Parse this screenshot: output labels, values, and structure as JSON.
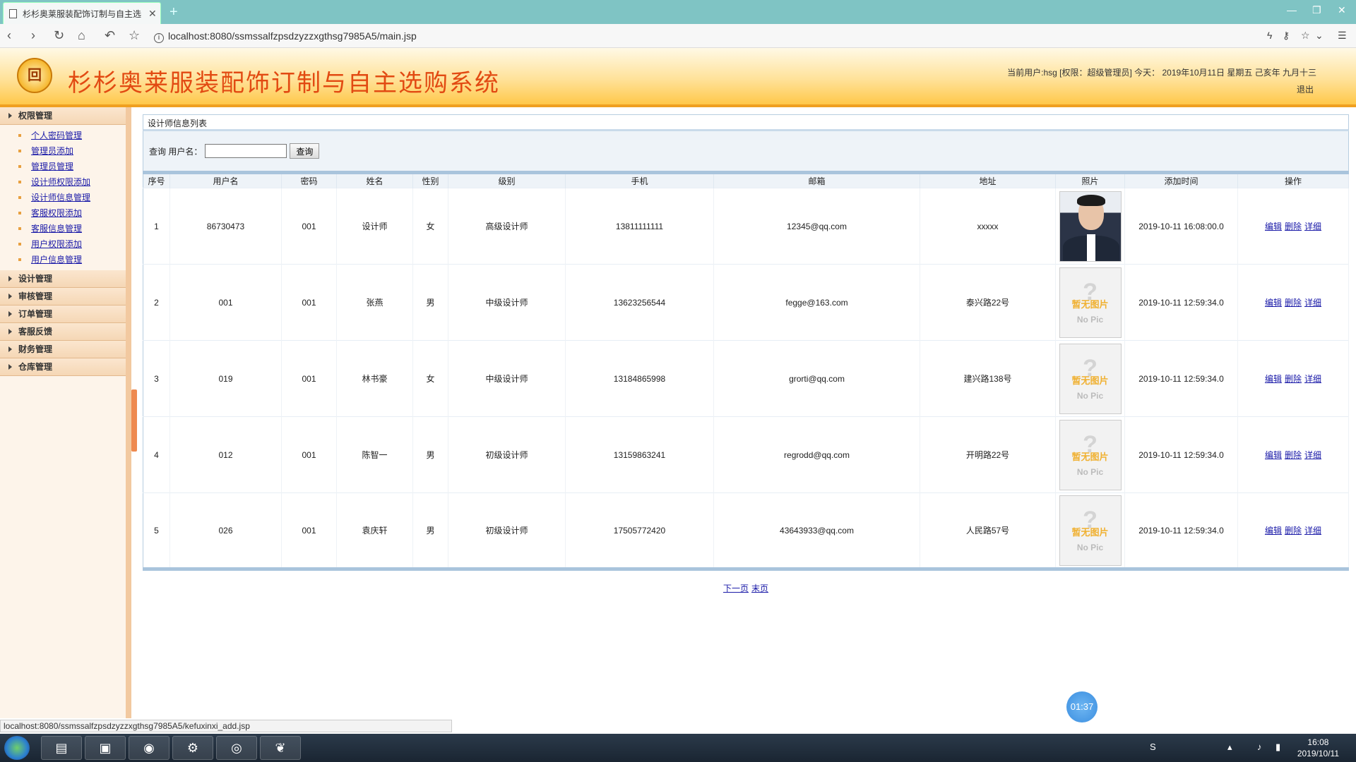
{
  "browser": {
    "tab_title": "杉杉奥莱服装配饰订制与自主选",
    "close": "✕",
    "new_tab": "+",
    "url": "localhost:8080/ssmssalfzpsdzyzzxgthsg7985A5/main.jsp",
    "info": "i",
    "status_url": "localhost:8080/ssmssalfzpsdzyzzxgthsg7985A5/kefuxinxi_add.jsp"
  },
  "header": {
    "logo": "回",
    "title": "杉杉奥莱服装配饰订制与自主选购系统",
    "user_info": "当前用户:hsg [权限：超级管理员] 今天： 2019年10月11日 星期五 己亥年 九月十三",
    "logout": "退出"
  },
  "sidebar": {
    "groups": [
      {
        "label": "权限管理",
        "items": [
          "个人密码管理",
          "管理员添加",
          "管理员管理",
          "设计师权限添加",
          "设计师信息管理",
          "客服权限添加",
          "客服信息管理",
          "用户权限添加",
          "用户信息管理"
        ]
      },
      {
        "label": "设计管理"
      },
      {
        "label": "审核管理"
      },
      {
        "label": "订单管理"
      },
      {
        "label": "客服反馈"
      },
      {
        "label": "财务管理"
      },
      {
        "label": "仓库管理"
      }
    ]
  },
  "main": {
    "panel_title": "设计师信息列表",
    "search_label": "查询 用户名：",
    "search_value": "",
    "search_button": "查询",
    "columns": [
      "序号",
      "用户名",
      "密码",
      "姓名",
      "性别",
      "级别",
      "手机",
      "邮箱",
      "地址",
      "照片",
      "添加时间",
      "操作"
    ],
    "rows": [
      {
        "no": "1",
        "username": "86730473",
        "password": "001",
        "name": "设计师",
        "gender": "女",
        "level": "高级设计师",
        "phone": "13811111111",
        "email": "12345@qq.com",
        "address": "xxxxx",
        "photo": "real",
        "time": "2019-10-11 16:08:00.0"
      },
      {
        "no": "2",
        "username": "001",
        "password": "001",
        "name": "张燕",
        "gender": "男",
        "level": "中级设计师",
        "phone": "13623256544",
        "email": "fegge@163.com",
        "address": "泰兴路22号",
        "photo": "none",
        "time": "2019-10-11 12:59:34.0"
      },
      {
        "no": "3",
        "username": "019",
        "password": "001",
        "name": "林书豪",
        "gender": "女",
        "level": "中级设计师",
        "phone": "13184865998",
        "email": "grorti@qq.com",
        "address": "建兴路138号",
        "photo": "none",
        "time": "2019-10-11 12:59:34.0"
      },
      {
        "no": "4",
        "username": "012",
        "password": "001",
        "name": "陈智一",
        "gender": "男",
        "level": "初级设计师",
        "phone": "13159863241",
        "email": "regrodd@qq.com",
        "address": "开明路22号",
        "photo": "none",
        "time": "2019-10-11 12:59:34.0"
      },
      {
        "no": "5",
        "username": "026",
        "password": "001",
        "name": "袁庆轩",
        "gender": "男",
        "level": "初级设计师",
        "phone": "17505772420",
        "email": "43643933@qq.com",
        "address": "人民路57号",
        "photo": "none",
        "time": "2019-10-11 12:59:34.0"
      }
    ],
    "ops": [
      "编辑",
      "删除",
      "详细"
    ],
    "nopic_q": "?",
    "nopic_cn": "暂无图片",
    "nopic_en": "No Pic",
    "pager": [
      "下一页",
      "末页"
    ]
  },
  "overlay": {
    "timer": "01:37"
  },
  "taskbar": {
    "time": "16:08",
    "date": "2019/10/11"
  }
}
